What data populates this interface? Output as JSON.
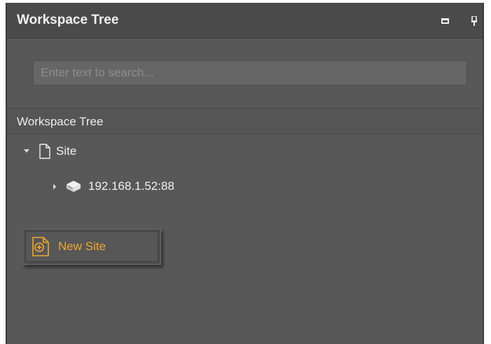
{
  "panel": {
    "title": "Workspace Tree",
    "buttons": {
      "maximize_icon": "maximize-icon",
      "pin_icon": "pin-icon"
    }
  },
  "search": {
    "placeholder": "Enter text to search...",
    "value": ""
  },
  "tree": {
    "header": "Workspace Tree",
    "nodes": [
      {
        "label": "Site",
        "icon": "document-icon",
        "expanded": true
      },
      {
        "label": "192.168.1.52:88",
        "icon": "server-icon",
        "expanded": false
      }
    ]
  },
  "context_menu": {
    "items": [
      {
        "label": "New Site",
        "icon": "new-site-icon"
      }
    ]
  },
  "colors": {
    "panel_bg": "#585858",
    "titlebar_bg": "#4a4a4a",
    "accent": "#f0a92e"
  }
}
